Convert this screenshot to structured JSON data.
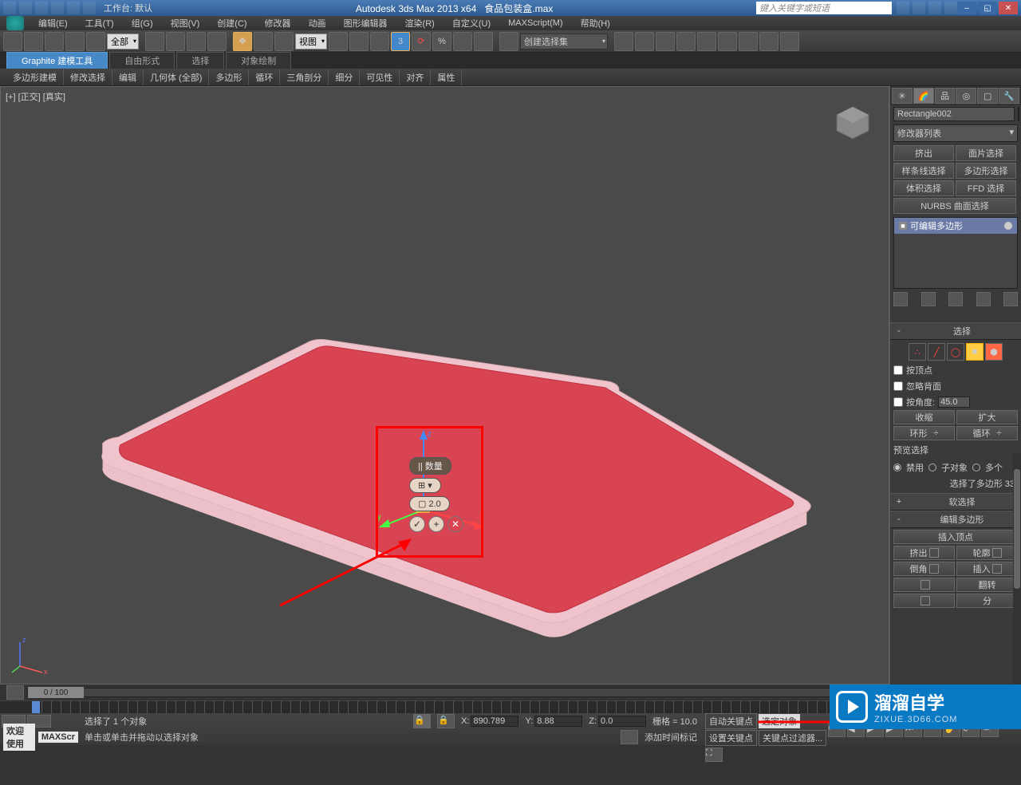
{
  "title": {
    "app": "Autodesk 3ds Max  2013 x64",
    "file": "食品包装盒.max",
    "workspace": "工作台: 默认",
    "search_ph": "键入关键字或短语"
  },
  "menu": [
    "编辑(E)",
    "工具(T)",
    "组(G)",
    "视图(V)",
    "创建(C)",
    "修改器",
    "动画",
    "图形编辑器",
    "渲染(R)",
    "自定义(U)",
    "MAXScript(M)",
    "帮助(H)"
  ],
  "toolbar": {
    "filter": "全部",
    "refcoord": "视图",
    "named_sel": "创建选择集"
  },
  "ribbon": {
    "tabs": [
      "Graphite 建模工具",
      "自由形式",
      "选择",
      "对象绘制"
    ],
    "sub": [
      "多边形建模",
      "修改选择",
      "编辑",
      "几何体 (全部)",
      "多边形",
      "循环",
      "三角剖分",
      "细分",
      "可见性",
      "对齐",
      "属性"
    ]
  },
  "viewport": {
    "label": "[+] [正交] [真实]"
  },
  "caddy": {
    "hdr": "|| 数量",
    "value": "2.0"
  },
  "cmd": {
    "obj_name": "Rectangle002",
    "mod_list": "修改器列表",
    "buttons": [
      [
        "挤出",
        "面片选择"
      ],
      [
        "样条线选择",
        "多边形选择"
      ],
      [
        "体积选择",
        "FFD 选择"
      ]
    ],
    "nurbs": "NURBS 曲面选择",
    "stack_item": "可编辑多边形",
    "sel_rollout": "选择",
    "checks": {
      "by_vertex": "按顶点",
      "ignore_back": "忽略背面",
      "by_angle": "按角度:",
      "angle_val": "45.0"
    },
    "shrink_grow": [
      "收缩",
      "扩大"
    ],
    "ring_loop": [
      "环形",
      "循环"
    ],
    "preview": "预览选择",
    "preview_opts": [
      "禁用",
      "子对象",
      "多个"
    ],
    "sel_info": "选择了多边形 33",
    "soft_sel": "软选择",
    "edit_poly": "编辑多边形",
    "insert_vtx": "插入顶点",
    "edit_btns": [
      [
        "挤出",
        "轮廓"
      ],
      [
        "倒角",
        "插入"
      ]
    ],
    "flip": "翻转",
    "fen": "分"
  },
  "time": {
    "range": "0 / 100"
  },
  "status": {
    "welcome": "欢迎使用",
    "script": "MAXScr",
    "sel_count": "选择了 1 个对象",
    "prompt": "单击或单击并拖动以选择对象",
    "x": "890.789",
    "y": "8.88",
    "z": "0.0",
    "grid": "栅格 = 10.0",
    "autokey": "自动关键点",
    "selset": "选定对象",
    "setkey": "设置关键点",
    "keyfilter": "关键点过滤器...",
    "add_time_tag": "添加时间标记"
  },
  "watermark": {
    "brand": "溜溜自学",
    "url": "ZIXUE.3D66.COM"
  }
}
